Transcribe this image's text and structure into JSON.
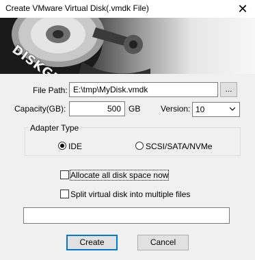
{
  "window": {
    "title": "Create VMware Virtual Disk(.vmdk File)",
    "close_glyph": "✕"
  },
  "banner": {
    "logo_text": "DISKGENIUS"
  },
  "form": {
    "file_path_label": "File Path:",
    "file_path_value": "E:\\tmp\\MyDisk.vmdk",
    "browse_label": "...",
    "capacity_label": "Capacity(GB):",
    "capacity_value": "500",
    "capacity_unit": "GB",
    "version_label": "Version:",
    "version_value": "10"
  },
  "adapter": {
    "group_label": "Adapter Type",
    "options": [
      {
        "label": "IDE",
        "selected": true
      },
      {
        "label": "SCSI/SATA/NVMe",
        "selected": false
      }
    ]
  },
  "options": {
    "allocate_label": "Allocate all disk space now",
    "allocate_checked": false,
    "split_label": "Split virtual disk into multiple files",
    "split_checked": false
  },
  "progress": {
    "value": 0
  },
  "buttons": {
    "create_label": "Create",
    "cancel_label": "Cancel"
  }
}
